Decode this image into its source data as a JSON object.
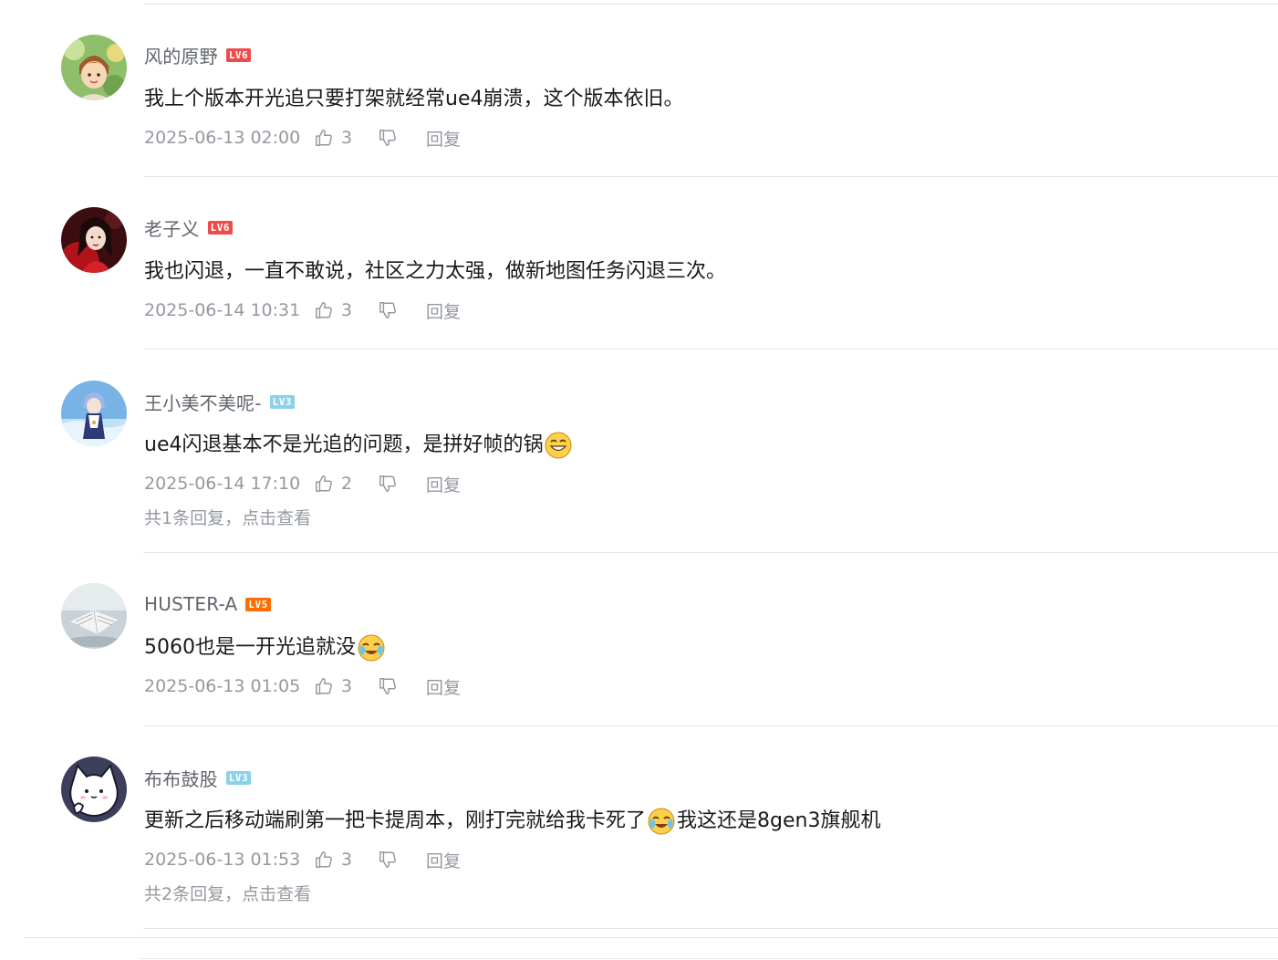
{
  "colors": {
    "divider": "#e3e5e7",
    "username": "#61666d",
    "meta": "#9499a0",
    "lv6": "#ee4b4b",
    "lv5": "#ff6c00",
    "lv3": "#8bd1ea"
  },
  "icons": {
    "like": "thumbs-up-icon",
    "dislike": "thumbs-down-icon"
  },
  "comments": [
    {
      "username": "风的原野",
      "level": "LV6",
      "text": "我上个版本开光追只要打架就经常ue4崩溃，这个版本依旧。",
      "date": "2025-06-13 02:00",
      "likes": "3",
      "reply_label": "回复"
    },
    {
      "username": "老子义",
      "level": "LV6",
      "text": "我也闪退，一直不敢说，社区之力太强，做新地图任务闪退三次。",
      "date": "2025-06-14 10:31",
      "likes": "3",
      "reply_label": "回复"
    },
    {
      "username": "王小美不美呢-",
      "level": "LV3",
      "text": "ue4闪退基本不是光追的问题，是拼好帧的锅",
      "emoji": "grin-emoji",
      "date": "2025-06-14 17:10",
      "likes": "2",
      "reply_label": "回复",
      "more_replies": "共1条回复，点击查看"
    },
    {
      "username": "HUSTER-A",
      "level": "LV5",
      "text": "5060也是一开光追就没",
      "emoji": "cry-laugh-emoji",
      "date": "2025-06-13 01:05",
      "likes": "3",
      "reply_label": "回复"
    },
    {
      "username": "布布鼓股",
      "level": "LV3",
      "text_before": "更新之后移动端刷第一把卡提周本，刚打完就给我卡死了",
      "emoji": "cry-laugh-emoji",
      "text_after": "我这还是8gen3旗舰机",
      "date": "2025-06-13 01:53",
      "likes": "3",
      "reply_label": "回复",
      "more_replies": "共2条回复，点击查看"
    }
  ]
}
